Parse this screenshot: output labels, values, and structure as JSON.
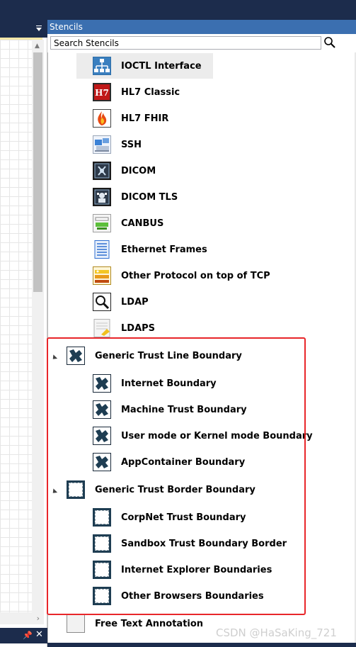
{
  "panel": {
    "title": "Stencils"
  },
  "search": {
    "value": "Search Stencils"
  },
  "items": [
    {
      "label": "IOCTL Interface",
      "icon": "ioctl-icon"
    },
    {
      "label": "HL7 Classic",
      "icon": "hl7-classic-icon"
    },
    {
      "label": "HL7 FHIR",
      "icon": "hl7-fhir-icon"
    },
    {
      "label": "SSH",
      "icon": "ssh-icon"
    },
    {
      "label": "DICOM",
      "icon": "dicom-icon"
    },
    {
      "label": "DICOM TLS",
      "icon": "dicom-tls-icon"
    },
    {
      "label": "CANBUS",
      "icon": "canbus-icon"
    },
    {
      "label": "Ethernet Frames",
      "icon": "ethernet-frames-icon"
    },
    {
      "label": "Other Protocol on top of TCP",
      "icon": "tcp-protocol-icon"
    },
    {
      "label": "LDAP",
      "icon": "ldap-icon"
    },
    {
      "label": "LDAPS",
      "icon": "ldaps-icon"
    }
  ],
  "groups": [
    {
      "label": "Generic Trust Line Boundary",
      "icon": "trust-line-boundary-icon",
      "children": [
        {
          "label": "Internet Boundary"
        },
        {
          "label": "Machine Trust Boundary"
        },
        {
          "label": "User mode or Kernel mode Boundary"
        },
        {
          "label": "AppContainer Boundary"
        }
      ]
    },
    {
      "label": "Generic Trust Border Boundary",
      "icon": "trust-border-boundary-icon",
      "children": [
        {
          "label": "CorpNet Trust Boundary"
        },
        {
          "label": "Sandbox Trust Boundary Border"
        },
        {
          "label": "Internet Explorer Boundaries"
        },
        {
          "label": "Other Browsers Boundaries"
        }
      ]
    }
  ],
  "annotation": {
    "label": "Free Text Annotation"
  },
  "watermark": "CSDN @HaSaKing_721",
  "colors": {
    "title_bar": "#3b6fb0",
    "dark_chrome": "#1c2c4c",
    "highlight_border": "#e8262a",
    "selected_row": "#ececec"
  }
}
